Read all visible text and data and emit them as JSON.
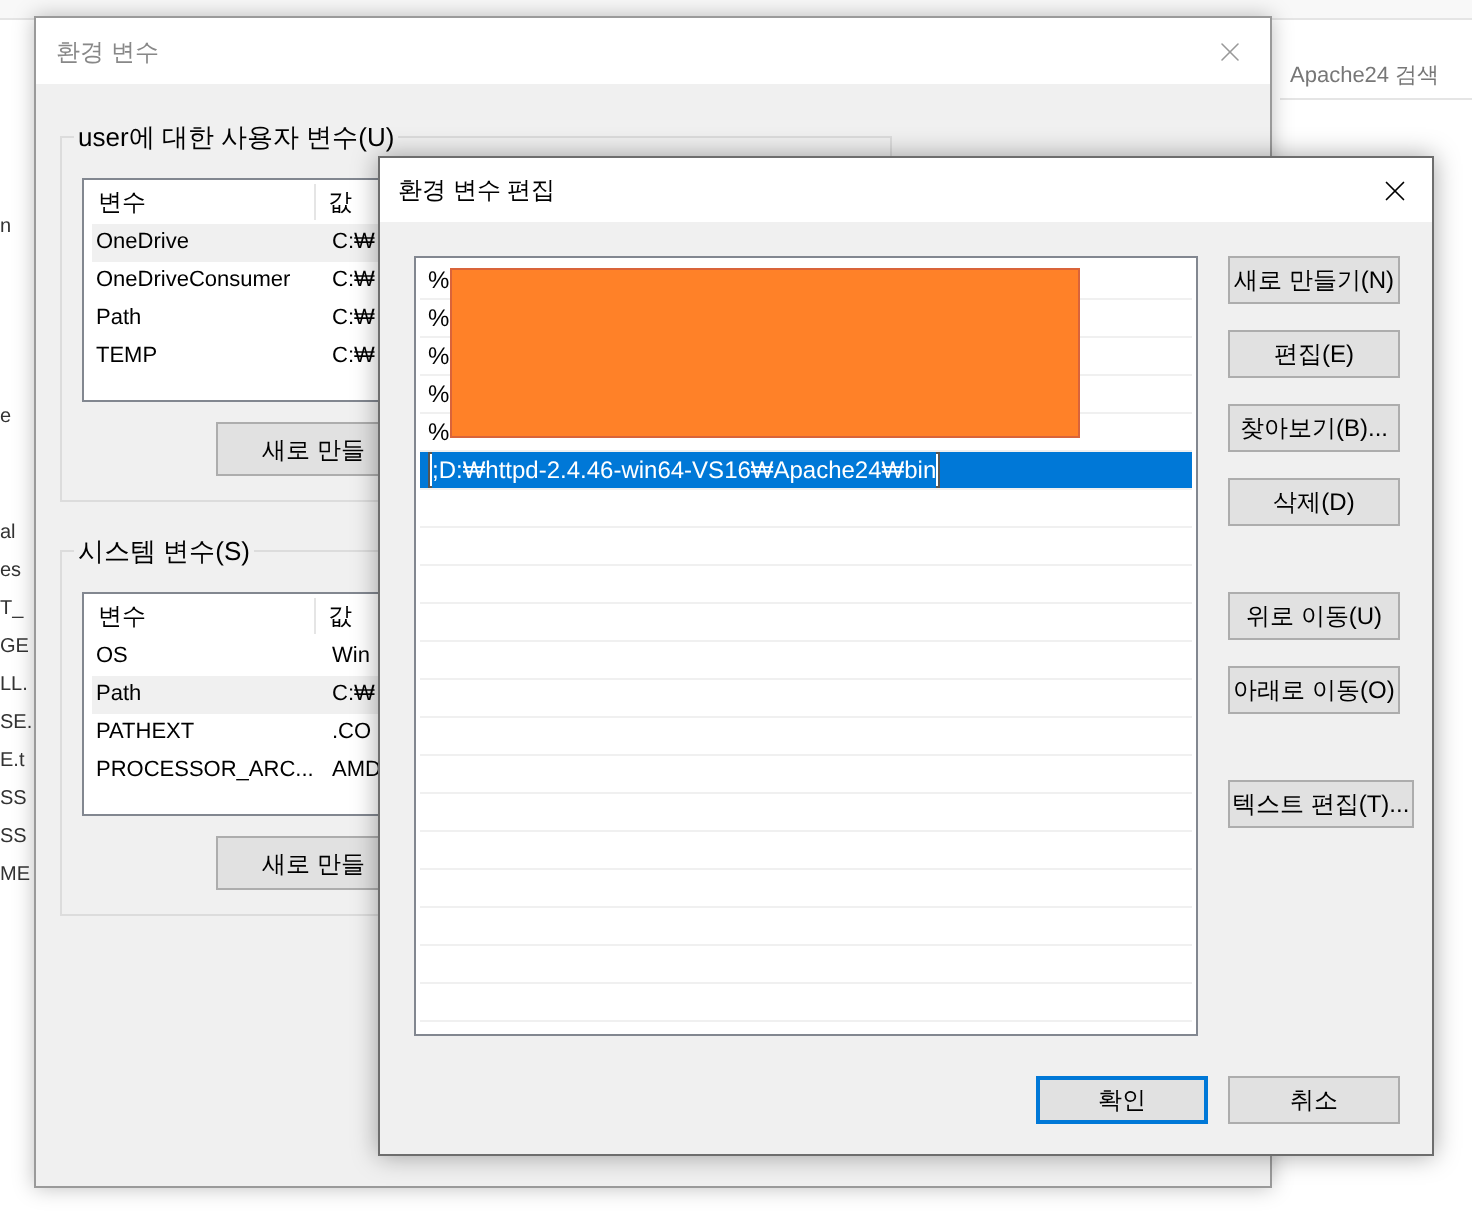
{
  "background_app": {
    "search_placeholder": "Apache24 검색",
    "side_items": [
      {
        "text": "n"
      },
      {
        "text": "e"
      },
      {
        "text": "al"
      },
      {
        "text": "es"
      },
      {
        "text": "T_"
      },
      {
        "text": "GE"
      },
      {
        "text": "LL."
      },
      {
        "text": "SE."
      },
      {
        "text": "E.t"
      },
      {
        "text": "SS"
      },
      {
        "text": "SS"
      },
      {
        "text": "ME"
      }
    ]
  },
  "env_dialog": {
    "title": "환경 변수",
    "groups": [
      {
        "label": "user에 대한 사용자 변수(U)",
        "columns": [
          "변수",
          "값"
        ],
        "rows": [
          {
            "name": "OneDrive",
            "value": "C:₩",
            "selected": true
          },
          {
            "name": "OneDriveConsumer",
            "value": "C:₩",
            "selected": false
          },
          {
            "name": "Path",
            "value": "C:₩",
            "selected": false
          },
          {
            "name": "TEMP",
            "value": "C:₩",
            "selected": false
          }
        ],
        "new_button": "새로 만들"
      },
      {
        "label": "시스템 변수(S)",
        "columns": [
          "변수",
          "값"
        ],
        "rows": [
          {
            "name": "OS",
            "value": "Win",
            "selected": false
          },
          {
            "name": "Path",
            "value": "C:₩",
            "selected": true
          },
          {
            "name": "PATHEXT",
            "value": ".CO",
            "selected": false
          },
          {
            "name": "PROCESSOR_ARC...",
            "value": "AMD",
            "selected": false
          }
        ],
        "new_button": "새로 만들"
      }
    ]
  },
  "edit_dialog": {
    "title": "환경 변수 편집",
    "redacted": true,
    "entries": [
      {
        "kind": "text",
        "text": "%",
        "selected": false
      },
      {
        "kind": "text",
        "text": "%",
        "selected": false
      },
      {
        "kind": "text",
        "text": "%",
        "selected": false
      },
      {
        "kind": "text",
        "text": "%",
        "selected": false
      },
      {
        "kind": "text",
        "text": "%",
        "selected": false
      },
      {
        "kind": "editing",
        "text": ";D:₩httpd-2.4.46-win64-VS16₩Apache24₩bin",
        "selected": true
      }
    ],
    "side_button_groups": [
      [
        "새로 만들기(N)",
        "편집(E)",
        "찾아보기(B)...",
        "삭제(D)"
      ],
      [
        "위로 이동(U)",
        "아래로 이동(O)"
      ],
      [
        "텍스트 편집(T)..."
      ]
    ],
    "ok_button": "확인",
    "cancel_button": "취소"
  }
}
